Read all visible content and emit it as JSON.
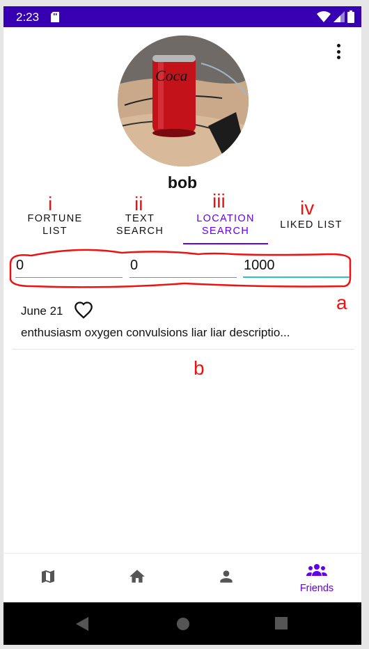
{
  "status_bar": {
    "time": "2:23"
  },
  "profile": {
    "username": "bob"
  },
  "annotations": {
    "i": "i",
    "ii": "ii",
    "iii": "iii",
    "iv": "iv",
    "a": "a",
    "b": "b"
  },
  "tabs": [
    {
      "line1": "FORTUNE",
      "line2": "LIST",
      "active": false
    },
    {
      "line1": "TEXT",
      "line2": "SEARCH",
      "active": false
    },
    {
      "line1": "LOCATION",
      "line2": "SEARCH",
      "active": true
    },
    {
      "line1": "LIKED LIST",
      "line2": "",
      "active": false
    }
  ],
  "location_search": {
    "field1": "0",
    "field2": "0",
    "field3": "1000"
  },
  "results": [
    {
      "date": "June 21",
      "text": "enthusiasm oxygen convulsions liar liar descriptio..."
    }
  ],
  "bottom_nav": [
    {
      "icon": "map-icon",
      "label": ""
    },
    {
      "icon": "home-icon",
      "label": ""
    },
    {
      "icon": "person-icon",
      "label": ""
    },
    {
      "icon": "friends-icon",
      "label": "Friends",
      "active": true
    }
  ],
  "colors": {
    "primary": "#6200ee",
    "status_bar": "#3700b3",
    "annotation": "#ee1111",
    "focus_underline": "#26c6c6"
  }
}
